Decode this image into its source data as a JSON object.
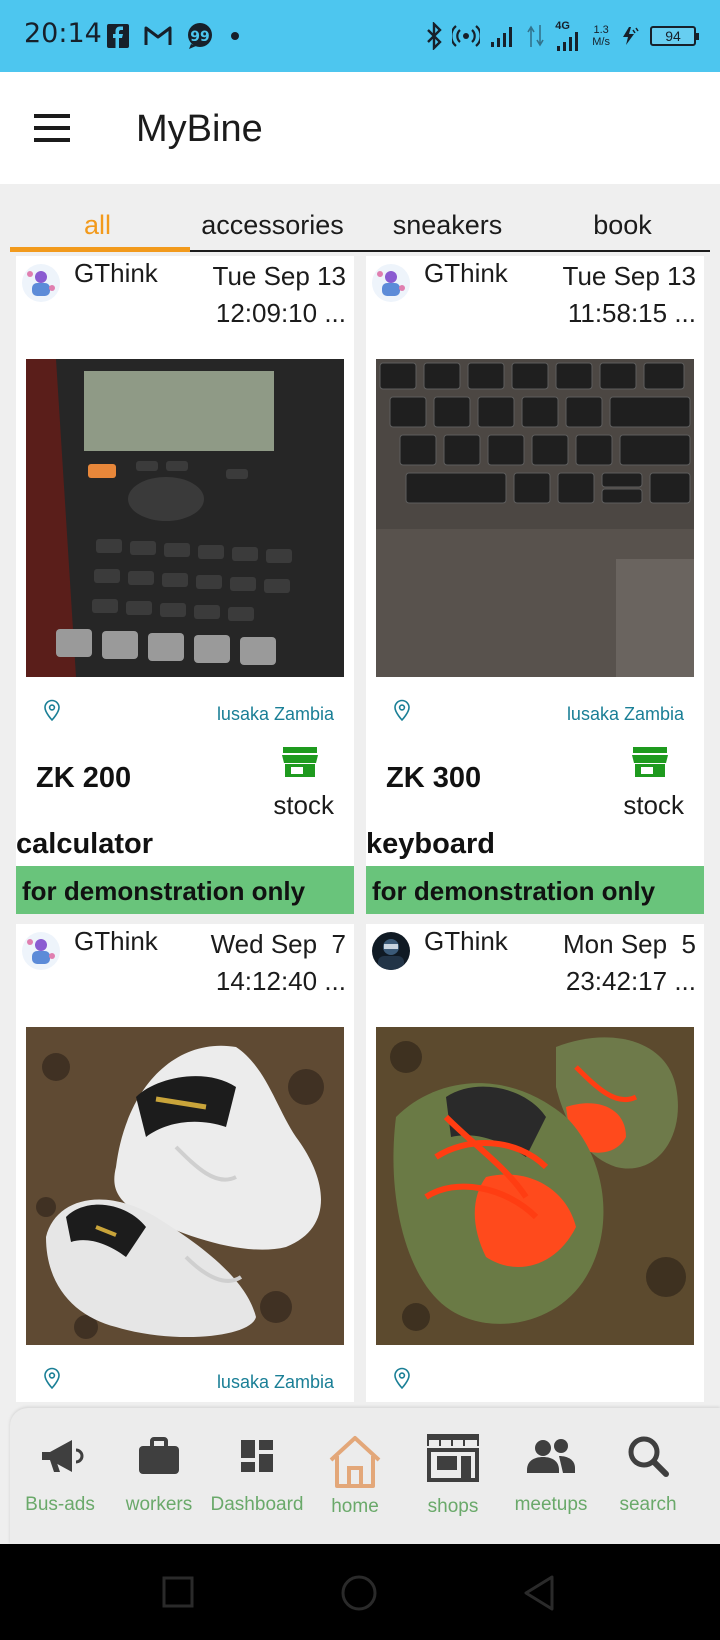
{
  "status_bar": {
    "time": "20:14",
    "network": "4G",
    "speed_value": "1.3",
    "speed_unit": "M/s",
    "battery": "94",
    "icons": [
      "facebook-icon",
      "gmail-icon",
      "chat-bubble-icon",
      "dot-icon",
      "bluetooth-icon",
      "hotspot-icon",
      "signal-icon",
      "battery-icon"
    ]
  },
  "app_bar": {
    "title": "MyBine",
    "menu_icon": "hamburger-menu-icon"
  },
  "tabs": [
    {
      "label": "all",
      "active": true
    },
    {
      "label": "accessories",
      "active": false
    },
    {
      "label": "sneakers",
      "active": false
    },
    {
      "label": "book",
      "active": false
    }
  ],
  "products": [
    {
      "seller": "GThink",
      "date_line1": "Tue Sep 13",
      "date_line2": "12:09:10 ...",
      "location": "lusaka Zambia",
      "price": "ZK 200",
      "stock_label": "stock",
      "name": "calculator",
      "note": "for demonstration only",
      "photo": "calculator-photo"
    },
    {
      "seller": "GThink",
      "date_line1": "Tue Sep 13",
      "date_line2": "11:58:15 ...",
      "location": "lusaka Zambia",
      "price": "ZK 300",
      "stock_label": "stock",
      "name": "keyboard",
      "note": "for demonstration only",
      "photo": "keyboard-photo"
    },
    {
      "seller": "GThink",
      "date_line1": "Wed Sep  7",
      "date_line2": "14:12:40 ...",
      "location": "lusaka Zambia",
      "photo": "white-sneakers-photo"
    },
    {
      "seller": "GThink",
      "date_line1": "Mon Sep  5",
      "date_line2": "23:42:17 ...",
      "photo": "green-orange-sneakers-photo"
    }
  ],
  "bottom_nav": [
    {
      "label": "Bus-ads",
      "icon": "megaphone-icon"
    },
    {
      "label": "workers",
      "icon": "briefcase-icon"
    },
    {
      "label": "Dashboard",
      "icon": "dashboard-icon"
    },
    {
      "label": "home",
      "icon": "home-icon",
      "active": true
    },
    {
      "label": "shops",
      "icon": "storefront-icon"
    },
    {
      "label": "meetups",
      "icon": "people-icon"
    },
    {
      "label": "search",
      "icon": "search-icon"
    }
  ],
  "colors": {
    "status_bar": "#4dc6ef",
    "accent": "#f29a1c",
    "demo_banner": "#69c47b",
    "nav_label": "#6aa96a",
    "location_text": "#1a7f96",
    "stock_icon": "#1e9a1e"
  }
}
